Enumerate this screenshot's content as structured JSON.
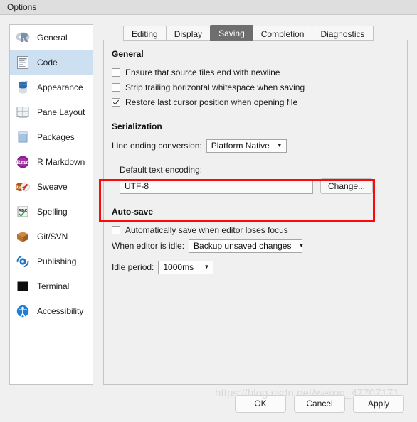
{
  "window": {
    "title": "Options"
  },
  "sidebar": {
    "items": [
      {
        "label": "General",
        "icon": "r-logo-icon",
        "selected": false
      },
      {
        "label": "Code",
        "icon": "code-file-icon",
        "selected": true
      },
      {
        "label": "Appearance",
        "icon": "paint-can-icon",
        "selected": false
      },
      {
        "label": "Pane Layout",
        "icon": "pane-grid-icon",
        "selected": false
      },
      {
        "label": "Packages",
        "icon": "package-box-icon",
        "selected": false
      },
      {
        "label": "R Markdown",
        "icon": "rmd-badge-icon",
        "selected": false
      },
      {
        "label": "Sweave",
        "icon": "sweave-pdf-icon",
        "selected": false
      },
      {
        "label": "Spelling",
        "icon": "spellcheck-icon",
        "selected": false
      },
      {
        "label": "Git/SVN",
        "icon": "git-box-icon",
        "selected": false
      },
      {
        "label": "Publishing",
        "icon": "publish-icon",
        "selected": false
      },
      {
        "label": "Terminal",
        "icon": "terminal-icon",
        "selected": false
      },
      {
        "label": "Accessibility",
        "icon": "accessibility-icon",
        "selected": false
      }
    ]
  },
  "tabs": [
    {
      "label": "Editing",
      "active": false
    },
    {
      "label": "Display",
      "active": false
    },
    {
      "label": "Saving",
      "active": true
    },
    {
      "label": "Completion",
      "active": false
    },
    {
      "label": "Diagnostics",
      "active": false
    }
  ],
  "saving": {
    "general": {
      "heading": "General",
      "checkboxes": [
        {
          "label": "Ensure that source files end with newline",
          "checked": false
        },
        {
          "label": "Strip trailing horizontal whitespace when saving",
          "checked": false
        },
        {
          "label": "Restore last cursor position when opening file",
          "checked": true
        }
      ]
    },
    "serialization": {
      "heading": "Serialization",
      "line_ending_label": "Line ending conversion:",
      "line_ending_value": "Platform Native"
    },
    "encoding": {
      "label": "Default text encoding:",
      "value": "UTF-8",
      "change_button": "Change...",
      "highlight_color": "#fb0a09"
    },
    "autosave": {
      "heading": "Auto-save",
      "checkbox": {
        "label": "Automatically save when editor loses focus",
        "checked": false
      },
      "idle_action_label": "When editor is idle:",
      "idle_action_value": "Backup unsaved changes",
      "idle_period_label": "Idle period:",
      "idle_period_value": "1000ms"
    }
  },
  "footer": {
    "ok": "OK",
    "cancel": "Cancel",
    "apply": "Apply"
  },
  "watermark": {
    "text": "https://blog.csdn.net/weixin_47707171"
  },
  "colors": {
    "selection": "#cde0f2",
    "active_tab": "#6e6e6e",
    "dialog_bg": "#f0f0f0",
    "titlebar_bg": "#dedede"
  }
}
